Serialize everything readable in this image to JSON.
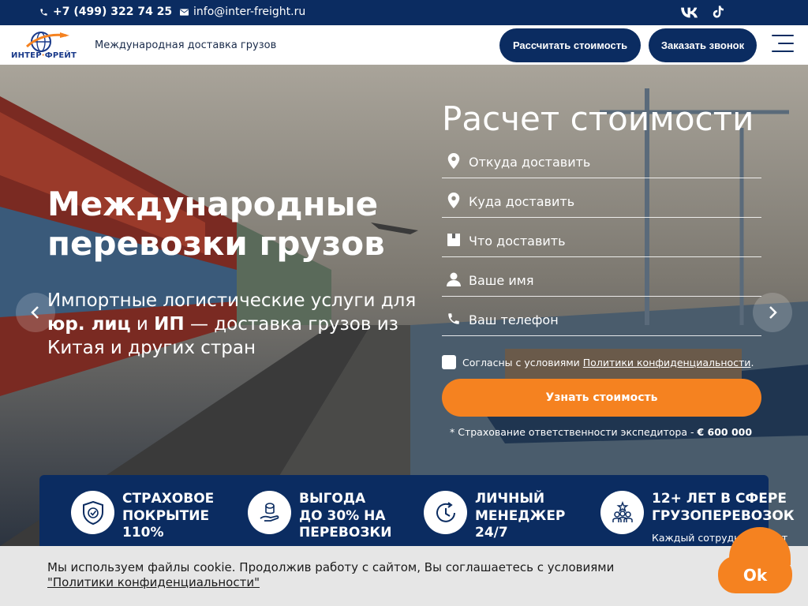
{
  "topbar": {
    "phone": "+7 (499) 322 74 25",
    "email": "info@inter-freight.ru",
    "social_icons": [
      "vk-icon",
      "tiktok-icon"
    ]
  },
  "header": {
    "logo_text_left": "ИНТЕР",
    "logo_text_right": "ФРЕЙТ",
    "tagline": "Международная доставка грузов",
    "btn_calc": "Рассчитать стоимость",
    "btn_call": "Заказать звонок"
  },
  "hero": {
    "title": "Международные перевозки грузов",
    "subtitle_1": "Импортные логистические услуги для ",
    "subtitle_b1": "юр. лиц",
    "subtitle_2": " и ",
    "subtitle_b2": "ИП",
    "subtitle_3": " — доставка грузов из Китая и других стран"
  },
  "form": {
    "title": "Расчет стоимости",
    "fields": [
      {
        "placeholder": "Откуда доставить",
        "icon": "map-pin-icon"
      },
      {
        "placeholder": "Куда доставить",
        "icon": "map-pin-icon"
      },
      {
        "placeholder": "Что доставить",
        "icon": "box-icon"
      },
      {
        "placeholder": "Ваше имя",
        "icon": "user-icon"
      },
      {
        "placeholder": "Ваш телефон",
        "icon": "phone-icon"
      }
    ],
    "agree_text": "Согласны с условиями ",
    "agree_link": "Политики конфиденциальности",
    "agree_dot": ".",
    "submit": "Узнать стоимость",
    "note_text": "* Страхование ответственности экспедитора - ",
    "note_value": "€ 600 000"
  },
  "features": [
    {
      "title_1": "СТРАХОВОЕ",
      "title_2": "ПОКРЫТИЕ",
      "title_3": "110%",
      "icon": "shield-check-icon"
    },
    {
      "title_1": "ВЫГОДА",
      "title_2": "ДО 30% НА",
      "title_3": "ПЕРЕВОЗКИ",
      "icon": "coins-hand-icon"
    },
    {
      "title_1": "ЛИЧНЫЙ",
      "title_2": "МЕНЕДЖЕР",
      "title_3": "24/7",
      "icon": "clock-24-icon"
    },
    {
      "title_1": "12+ ЛЕТ В СФЕРЕ",
      "title_2": "ГРУЗОПЕРЕВОЗОК",
      "title_3": "",
      "desc": "Каждый сотрудник имеет",
      "icon": "team-star-icon"
    }
  ],
  "cookie": {
    "text": "Мы используем файлы cookie. Продолжив работу с сайтом, Вы соглашаетесь с условиями ",
    "link": "\"Политики конфиденциальности\"",
    "ok": "Ok"
  },
  "colors": {
    "navy": "#0b2c61",
    "orange": "#f58220"
  }
}
